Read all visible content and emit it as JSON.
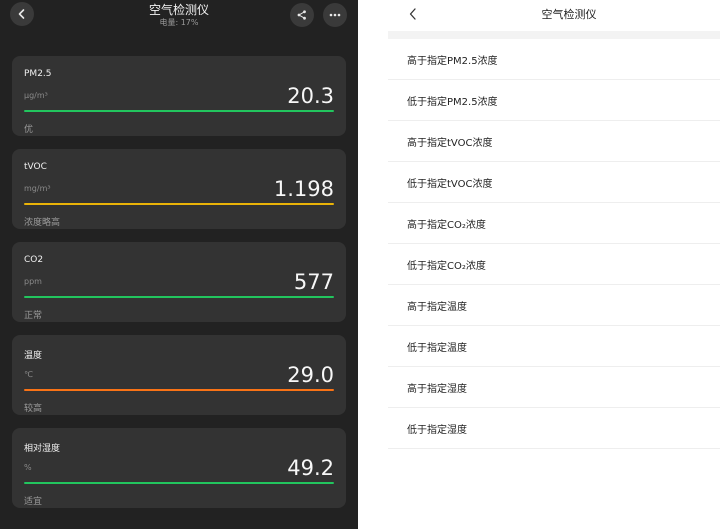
{
  "left": {
    "title": "空气检测仪",
    "battery": "电量: 17%",
    "icons": {
      "back": "chevron-left-icon",
      "share": "share-icon",
      "more": "more-icon"
    },
    "cards": [
      {
        "name": "PM2.5",
        "unit": "μg/m³",
        "value": "20.3",
        "status": "优",
        "bar_color": "#22c55e"
      },
      {
        "name": "tVOC",
        "unit": "mg/m³",
        "value": "1.198",
        "status": "浓度略高",
        "bar_color": "#eab308"
      },
      {
        "name": "CO2",
        "unit": "ppm",
        "value": "577",
        "status": "正常",
        "bar_color": "#22c55e"
      },
      {
        "name": "温度",
        "unit": "℃",
        "value": "29.0",
        "status": "较高",
        "bar_color": "#f97316"
      },
      {
        "name": "相对湿度",
        "unit": "%",
        "value": "49.2",
        "status": "适宜",
        "bar_color": "#22c55e"
      }
    ]
  },
  "right": {
    "title": "空气检测仪",
    "back_icon": "chevron-left-icon",
    "options": [
      "高于指定PM2.5浓度",
      "低于指定PM2.5浓度",
      "高于指定tVOC浓度",
      "低于指定tVOC浓度",
      "高于指定CO₂浓度",
      "低于指定CO₂浓度",
      "高于指定温度",
      "低于指定温度",
      "高于指定湿度",
      "低于指定湿度"
    ]
  }
}
